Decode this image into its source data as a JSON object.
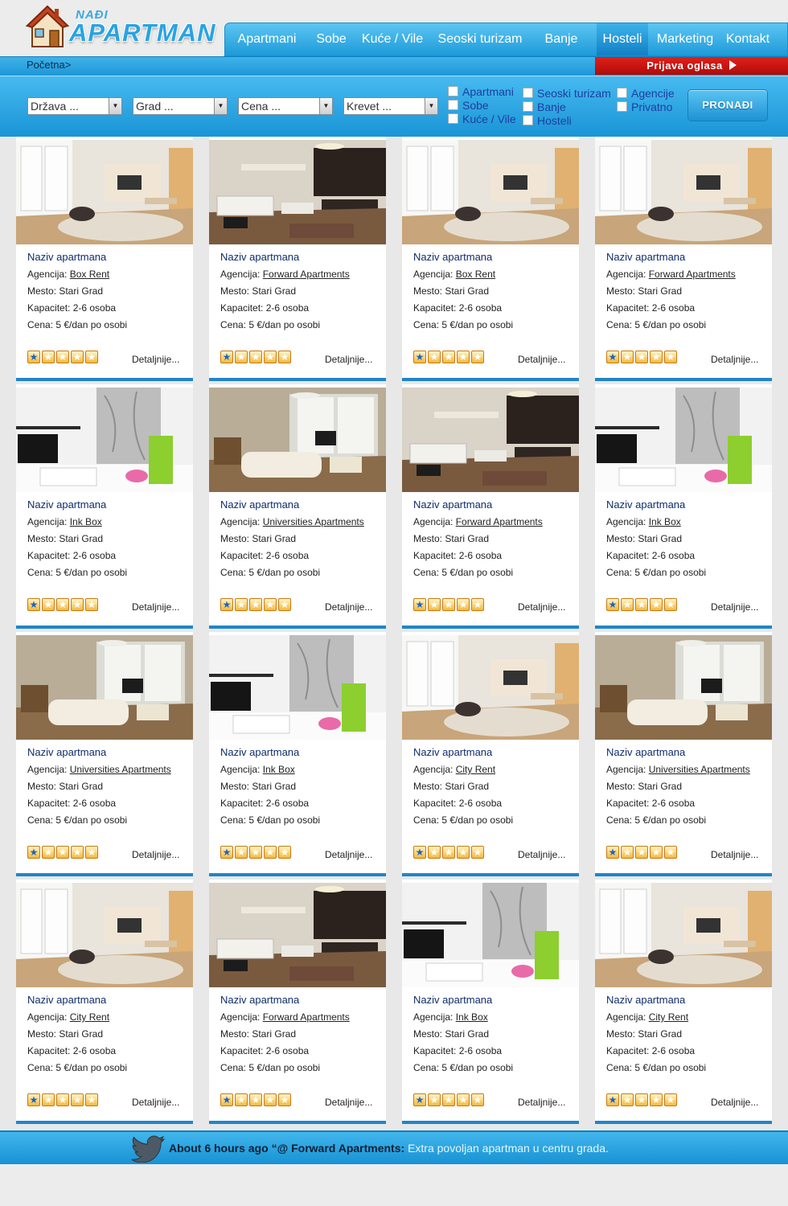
{
  "logo": {
    "pre": "NAĐI",
    "main": "APARTMAN"
  },
  "nav": [
    {
      "label": "Apartmani",
      "x": 0
    },
    {
      "label": "Sobe"
    },
    {
      "label": "Kuće / Vile"
    },
    {
      "label": "Seoski turizam"
    },
    {
      "label": "Banje"
    },
    {
      "label": "Hosteli"
    },
    {
      "label": "Marketing"
    },
    {
      "label": "Kontakt"
    }
  ],
  "breadcrumb": "Početna>",
  "post_ad": "Prijava oglasa",
  "search": {
    "selects": [
      "Država ...",
      "Grad ...",
      "Cena ...",
      "Krevet ..."
    ],
    "types_col1": [
      "Apartmani",
      "Sobe",
      "Kuće / Vile"
    ],
    "types_col2": [
      "Seoski turizam",
      "Banje",
      "Hosteli"
    ],
    "types_col3": [
      "Agencije",
      "Privatno"
    ],
    "button": "PRONAĐI"
  },
  "listings": [
    {
      "title": "Naziv apartmana",
      "agency_label": "Agencija:",
      "agency": "Box Rent",
      "city": "Mesto: Stari Grad",
      "capacity": "Kapacitet: 2-6 osoba",
      "price": "Cena: 5 €/dan po osobi",
      "rating": 1,
      "more": "Detaljnije..."
    },
    {
      "title": "Naziv apartmana",
      "agency_label": "Agencija:",
      "agency": "Forward Apartments",
      "city": "Mesto: Stari Grad",
      "capacity": "Kapacitet: 2-6 osoba",
      "price": "Cena: 5 €/dan po osobi",
      "rating": 1,
      "more": "Detaljnije..."
    },
    {
      "title": "Naziv apartmana",
      "agency_label": "Agencija:",
      "agency": "Box Rent",
      "city": "Mesto: Stari Grad",
      "capacity": "Kapacitet: 2-6 osoba",
      "price": "Cena: 5 €/dan po osobi",
      "rating": 1,
      "more": "Detaljnije..."
    },
    {
      "title": "Naziv apartmana",
      "agency_label": "Agencija:",
      "agency": "Forward Apartments",
      "city": "Mesto: Stari Grad",
      "capacity": "Kapacitet: 2-6 osoba",
      "price": "Cena: 5 €/dan po osobi",
      "rating": 1,
      "more": "Detaljnije..."
    },
    {
      "title": "Naziv apartmana",
      "agency_label": "Agencija:",
      "agency": "Ink Box",
      "city": "Mesto: Stari Grad",
      "capacity": "Kapacitet: 2-6 osoba",
      "price": "Cena: 5 €/dan po osobi",
      "rating": 1,
      "more": "Detaljnije..."
    },
    {
      "title": "Naziv apartmana",
      "agency_label": "Agencija:",
      "agency": "Universities Apartments",
      "city": "Mesto: Stari Grad",
      "capacity": "Kapacitet: 2-6 osoba",
      "price": "Cena: 5 €/dan po osobi",
      "rating": 1,
      "more": "Detaljnije..."
    },
    {
      "title": "Naziv apartmana",
      "agency_label": "Agencija:",
      "agency": "Forward Apartments",
      "city": "Mesto: Stari Grad",
      "capacity": "Kapacitet: 2-6 osoba",
      "price": "Cena: 5 €/dan po osobi",
      "rating": 1,
      "more": "Detaljnije..."
    },
    {
      "title": "Naziv apartmana",
      "agency_label": "Agencija:",
      "agency": "Ink Box",
      "city": "Mesto: Stari Grad",
      "capacity": "Kapacitet: 2-6 osoba",
      "price": "Cena: 5 €/dan po osobi",
      "rating": 1,
      "more": "Detaljnije..."
    },
    {
      "title": "Naziv apartmana",
      "agency_label": "Agencija:",
      "agency": "Universities Apartments",
      "city": "Mesto: Stari Grad",
      "capacity": "Kapacitet: 2-6 osoba",
      "price": "Cena: 5 €/dan po osobi",
      "rating": 1,
      "more": "Detaljnije..."
    },
    {
      "title": "Naziv apartmana",
      "agency_label": "Agencija:",
      "agency": "Ink Box",
      "city": "Mesto: Stari Grad",
      "capacity": "Kapacitet: 2-6 osoba",
      "price": "Cena: 5 €/dan po osobi",
      "rating": 1,
      "more": "Detaljnije..."
    },
    {
      "title": "Naziv apartmana",
      "agency_label": "Agencija:",
      "agency": "City Rent",
      "city": "Mesto: Stari Grad",
      "capacity": "Kapacitet: 2-6 osoba",
      "price": "Cena: 5 €/dan po osobi",
      "rating": 1,
      "more": "Detaljnije..."
    },
    {
      "title": "Naziv apartmana",
      "agency_label": "Agencija:",
      "agency": "Universities Apartments",
      "city": "Mesto: Stari Grad",
      "capacity": "Kapacitet: 2-6 osoba",
      "price": "Cena: 5 €/dan po osobi",
      "rating": 1,
      "more": "Detaljnije..."
    },
    {
      "title": "Naziv apartmana",
      "agency_label": "Agencija:",
      "agency": "City Rent",
      "city": "Mesto: Stari Grad",
      "capacity": "Kapacitet: 2-6 osoba",
      "price": "Cena: 5 €/dan po osobi",
      "rating": 1,
      "more": "Detaljnije..."
    },
    {
      "title": "Naziv apartmana",
      "agency_label": "Agencija:",
      "agency": "Forward Apartments",
      "city": "Mesto: Stari Grad",
      "capacity": "Kapacitet: 2-6 osoba",
      "price": "Cena: 5 €/dan po osobi",
      "rating": 1,
      "more": "Detaljnije..."
    },
    {
      "title": "Naziv apartmana",
      "agency_label": "Agencija:",
      "agency": "Ink Box",
      "city": "Mesto: Stari Grad",
      "capacity": "Kapacitet: 2-6 osoba",
      "price": "Cena: 5 €/dan po osobi",
      "rating": 1,
      "more": "Detaljnije..."
    },
    {
      "title": "Naziv apartmana",
      "agency_label": "Agencija:",
      "agency": "City Rent",
      "city": "Mesto: Stari Grad",
      "capacity": "Kapacitet: 2-6 osoba",
      "price": "Cena: 5 €/dan po osobi",
      "rating": 1,
      "more": "Detaljnije..."
    }
  ],
  "photo_scenes": [
    "room-a",
    "room-b",
    "room-a",
    "room-a",
    "room-c",
    "room-d",
    "room-b",
    "room-c",
    "room-d",
    "room-c",
    "room-a",
    "room-d",
    "room-a",
    "room-b",
    "room-c",
    "room-a"
  ],
  "rating_max": 5,
  "tweet": {
    "time": "About 6 hours ago",
    "prefix": "“@",
    "author": "Forward Apartments:",
    "text": "Extra povoljan apartman u centru grada."
  },
  "colors": {
    "accent": "#1e9ad9",
    "post_ad": "#d01510",
    "link": "#0e2c6c"
  }
}
